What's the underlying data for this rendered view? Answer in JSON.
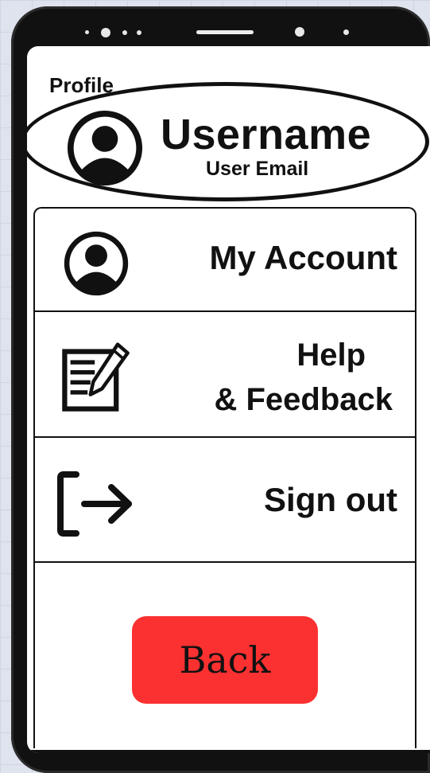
{
  "profile": {
    "section_label": "Profile",
    "username": "Username",
    "email": "User Email",
    "avatar_icon": "user-circle-icon"
  },
  "menu": {
    "items": [
      {
        "label": "My Account",
        "icon": "user-circle-icon",
        "highlighted": true
      },
      {
        "label_line1": "Help",
        "label_line2": "& Feedback",
        "icon": "edit-document-icon"
      },
      {
        "label": "Sign out",
        "icon": "sign-out-arrow-icon"
      }
    ]
  },
  "back_button": {
    "label": "Back",
    "color": "#fb3131"
  }
}
